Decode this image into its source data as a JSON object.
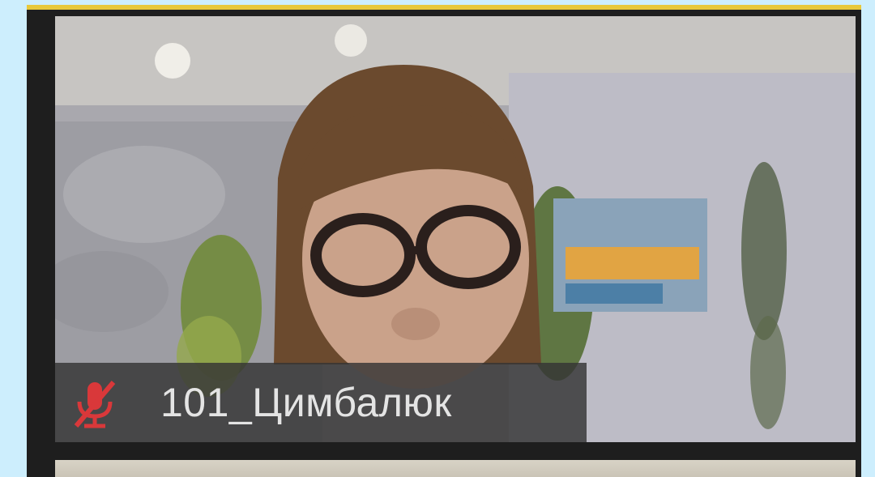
{
  "participant": {
    "name": "101_Цимбалюк",
    "mic_status": "muted",
    "mic_icon": "mic-muted-icon"
  },
  "colors": {
    "page_background": "#cdeefd",
    "frame": "#1e1e1e",
    "active_speaker_border": "#e8c83a",
    "name_bar": "#343434",
    "mic_muted": "#d9383a"
  }
}
